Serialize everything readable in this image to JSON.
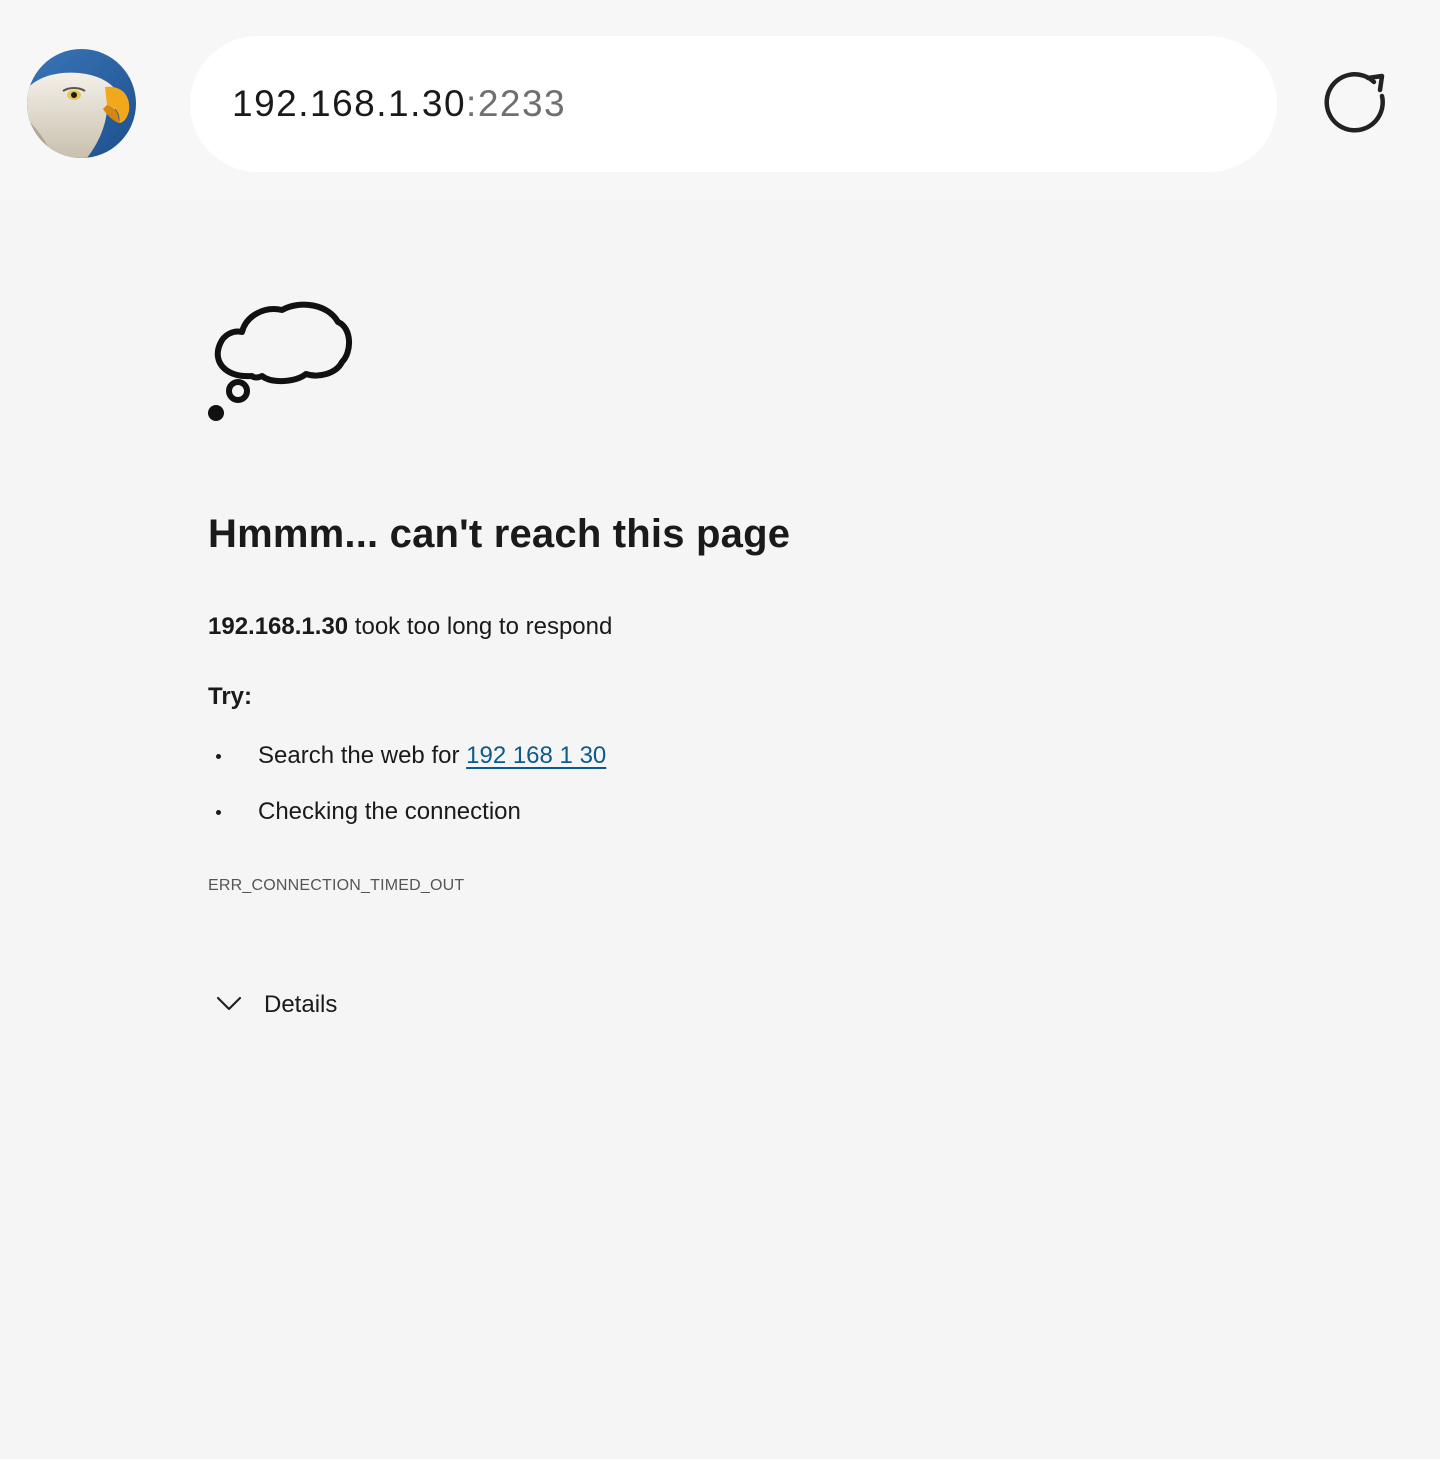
{
  "address_bar": {
    "host": "192.168.1.30",
    "port": ":2233"
  },
  "error_page": {
    "heading": "Hmmm... can't reach this page",
    "host_bold": "192.168.1.30",
    "message_rest": " took too long to respond",
    "try_label": "Try:",
    "suggestions": [
      {
        "prefix": "Search the web for ",
        "link_text": "192 168 1 30"
      },
      {
        "text": "Checking the connection"
      }
    ],
    "error_code": "ERR_CONNECTION_TIMED_OUT",
    "details_label": "Details"
  },
  "icons": {
    "avatar": "eagle-avatar",
    "reload": "reload-icon",
    "cloud": "thought-cloud-icon",
    "details": "chevron-down-icon"
  },
  "colors": {
    "background": "#f5f5f5",
    "link": "#0b5a8a",
    "port_text": "#6f6f6f"
  }
}
